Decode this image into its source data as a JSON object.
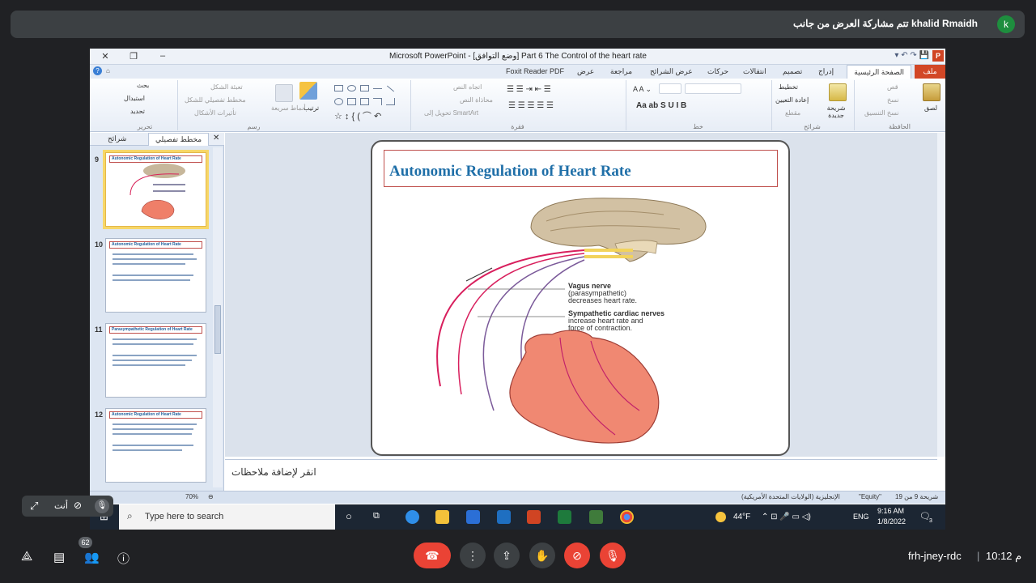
{
  "meet": {
    "presenter_banner": "تتم مشاركة العرض من جانب",
    "presenter_name": "khalid Rmaidh",
    "avatar_letter": "k",
    "self_label": "أنت",
    "participants_count": "62",
    "meeting_code": "frh-jney-rdc",
    "time": "10:12 م"
  },
  "window": {
    "title": "Microsoft PowerPoint - [وضع التوافق] Part 6 The Control of the heart rate",
    "app_logo": "P"
  },
  "ribbon": {
    "tabs": [
      "ملف",
      "الصفحة الرئيسية",
      "إدراج",
      "تصميم",
      "انتقالات",
      "حركات",
      "عرض الشرائح",
      "مراجعة",
      "عرض",
      "Foxit Reader PDF"
    ],
    "groups": [
      "الحافظة",
      "شرائح",
      "خط",
      "فقرة",
      "رسم",
      "تحرير"
    ],
    "labels": {
      "paste": "لصق",
      "cut": "قص",
      "copy": "نسخ",
      "format_painter": "نسخ التنسيق",
      "new_slide": "شريحة جديدة",
      "layout": "تخطيط",
      "reset": "إعادة التعيين",
      "section": "مقطع",
      "arrange": "ترتيب",
      "quick_styles": "أنماط سريعة",
      "shape_fill": "تعبئة الشكل",
      "shape_outline": "مخطط تفصيلي للشكل",
      "shape_effects": "تأثيرات الأشكال",
      "find": "بحث",
      "replace": "استبدال",
      "select": "تحديد",
      "text_direction": "اتجاه النص",
      "align_text": "محاذاة النص",
      "smartart": "تحويل إلى SmartArt"
    }
  },
  "panel": {
    "tab_outline": "مخطط تفصيلي",
    "tab_slides": "شرائح",
    "thumbnails": [
      {
        "num": "9",
        "title": "Autonomic Regulation of Heart Rate"
      },
      {
        "num": "10",
        "title": "Autonomic Regulation of Heart Rate"
      },
      {
        "num": "11",
        "title": "Parasympathetic Regulation of Heart Rate"
      },
      {
        "num": "12",
        "title": "Autonomic Regulation of Heart Rate"
      }
    ]
  },
  "slide": {
    "title": "Autonomic Regulation of Heart Rate",
    "vagus_label": "Vagus nerve",
    "vagus_sub1": "(parasympathetic)",
    "vagus_sub2": "decreases heart rate.",
    "symp_label": "Sympathetic cardiac nerves",
    "symp_sub1": "increase heart rate and",
    "symp_sub2": "force of contraction."
  },
  "notes": {
    "placeholder": "انقر لإضافة ملاحظات"
  },
  "status": {
    "slide_of": "شريحة 9 من 19",
    "theme": "\"Equity\"",
    "language": "الإنجليزية (الولايات المتحدة الأمريكية)",
    "zoom": "70%"
  },
  "taskbar": {
    "search_placeholder": "Type here to search",
    "temperature": "44°F",
    "lang": "ENG",
    "time": "9:16 AM",
    "date": "1/8/2022",
    "notif_count": "3"
  }
}
